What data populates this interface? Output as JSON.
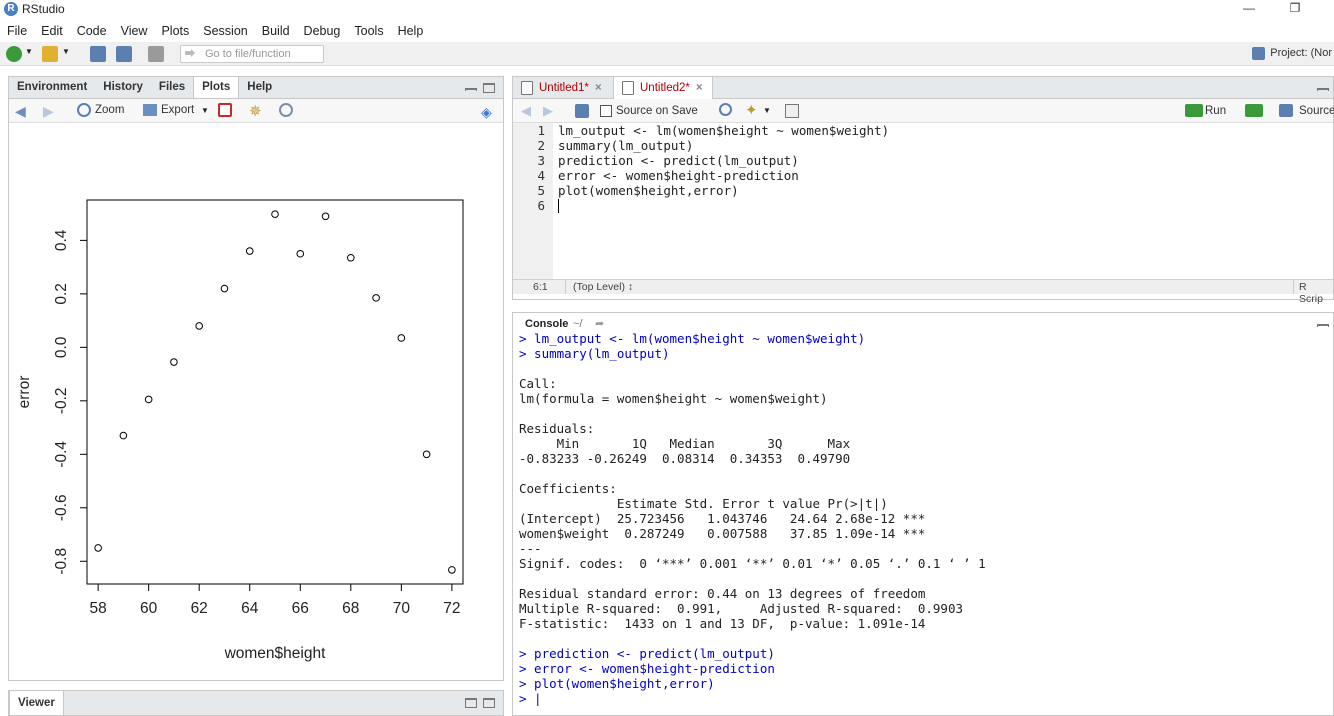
{
  "app": {
    "title": "RStudio",
    "logo_letter": "R"
  },
  "menu": [
    "File",
    "Edit",
    "Code",
    "View",
    "Plots",
    "Session",
    "Build",
    "Debug",
    "Tools",
    "Help"
  ],
  "toolbar": {
    "goto_placeholder": "Go to file/function",
    "project_label": "Project: (Nor"
  },
  "files_pane": {
    "tabs": [
      "Environment",
      "History",
      "Files",
      "Plots",
      "Help"
    ],
    "active_tab": "Plots",
    "zoom_label": "Zoom",
    "export_label": "Export"
  },
  "viewer_pane": {
    "tab": "Viewer"
  },
  "editor": {
    "tabs": [
      {
        "label": "Untitled1*",
        "active": false
      },
      {
        "label": "Untitled2*",
        "active": true
      }
    ],
    "source_on_save_label": "Source on Save",
    "run_label": "Run",
    "source_label": "Source",
    "lines": [
      "lm_output <- lm(women$height ~ women$weight)",
      "summary(lm_output)",
      "prediction <- predict(lm_output)",
      "error <- women$height-prediction",
      "plot(women$height,error)",
      ""
    ],
    "status": {
      "position": "6:1",
      "scope": "(Top Level) ↕",
      "file_type": "R Scrip"
    }
  },
  "console": {
    "title": "Console",
    "path": "~/",
    "lines": [
      {
        "kind": "in",
        "text": "> lm_output <- lm(women$height ~ women$weight)"
      },
      {
        "kind": "in",
        "text": "> summary(lm_output)"
      },
      {
        "kind": "out",
        "text": ""
      },
      {
        "kind": "out",
        "text": "Call:"
      },
      {
        "kind": "out",
        "text": "lm(formula = women$height ~ women$weight)"
      },
      {
        "kind": "out",
        "text": ""
      },
      {
        "kind": "out",
        "text": "Residuals:"
      },
      {
        "kind": "out",
        "text": "     Min       1Q   Median       3Q      Max "
      },
      {
        "kind": "out",
        "text": "-0.83233 -0.26249  0.08314  0.34353  0.49790 "
      },
      {
        "kind": "out",
        "text": ""
      },
      {
        "kind": "out",
        "text": "Coefficients:"
      },
      {
        "kind": "out",
        "text": "             Estimate Std. Error t value Pr(>|t|)    "
      },
      {
        "kind": "out",
        "text": "(Intercept)  25.723456   1.043746   24.64 2.68e-12 ***"
      },
      {
        "kind": "out",
        "text": "women$weight  0.287249   0.007588   37.85 1.09e-14 ***"
      },
      {
        "kind": "out",
        "text": "---"
      },
      {
        "kind": "out",
        "text": "Signif. codes:  0 ‘***’ 0.001 ‘**’ 0.01 ‘*’ 0.05 ‘.’ 0.1 ‘ ’ 1"
      },
      {
        "kind": "out",
        "text": ""
      },
      {
        "kind": "out",
        "text": "Residual standard error: 0.44 on 13 degrees of freedom"
      },
      {
        "kind": "out",
        "text": "Multiple R-squared:  0.991,\tAdjusted R-squared:  0.9903 "
      },
      {
        "kind": "out",
        "text": "F-statistic:  1433 on 1 and 13 DF,  p-value: 1.091e-14"
      },
      {
        "kind": "out",
        "text": ""
      },
      {
        "kind": "in",
        "text": "> prediction <- predict(lm_output)"
      },
      {
        "kind": "in",
        "text": "> error <- women$height-prediction"
      },
      {
        "kind": "in",
        "text": "> plot(women$height,error)"
      },
      {
        "kind": "in",
        "text": "> |"
      }
    ]
  },
  "chart_data": {
    "type": "scatter",
    "title": "",
    "xlabel": "women$height",
    "ylabel": "error",
    "x": [
      58,
      59,
      60,
      61,
      62,
      63,
      64,
      65,
      66,
      67,
      68,
      69,
      70,
      71,
      72
    ],
    "y": [
      -0.75,
      -0.33,
      -0.195,
      -0.055,
      0.08,
      0.22,
      0.36,
      0.4979,
      0.35,
      0.49,
      0.335,
      0.185,
      0.035,
      -0.4,
      -0.8323
    ],
    "xticks": [
      "58",
      "60",
      "62",
      "64",
      "66",
      "68",
      "70",
      "72"
    ],
    "yticks": [
      "-0.8",
      "-0.6",
      "-0.4",
      "-0.2",
      "0.0",
      "0.2",
      "0.4"
    ],
    "xlim": [
      57.56,
      72.44
    ],
    "ylim": [
      -0.885,
      0.551
    ],
    "marker": "open-circle",
    "grid": false
  }
}
